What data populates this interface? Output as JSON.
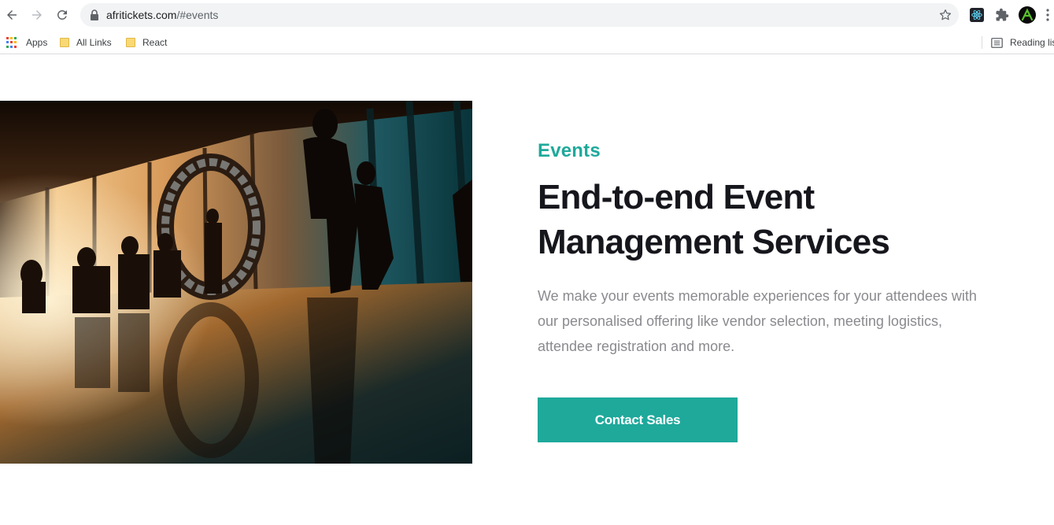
{
  "browser": {
    "url_host": "afritickets.com",
    "url_path": "/#events",
    "bookmarks": [
      {
        "label": "Apps"
      },
      {
        "label": "All Links"
      },
      {
        "label": "React"
      }
    ],
    "reading_list_label": "Reading lis"
  },
  "section": {
    "eyebrow": "Events",
    "headline_line1": "End-to-end Event",
    "headline_line2": "Management Services",
    "description": "We make your events memorable experiences for your attendees with our personalised offering like vendor selection, meeting logistics, attendee registration and more.",
    "cta_label": "Contact Sales"
  },
  "colors": {
    "accent": "#1ea99b",
    "headline": "#16161d",
    "body_text": "#8a8a8f"
  }
}
